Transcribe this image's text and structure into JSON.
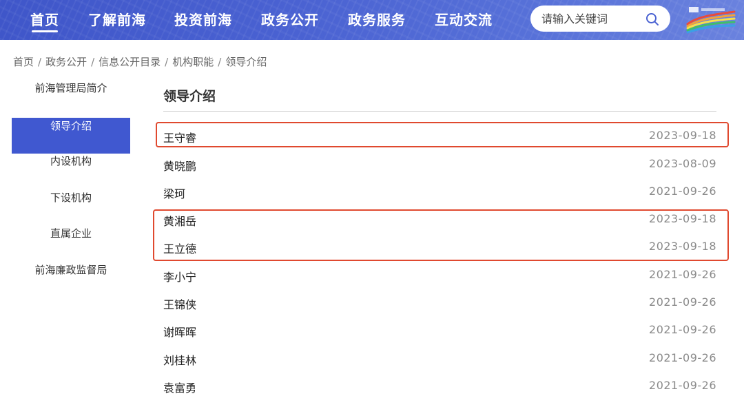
{
  "header": {
    "nav": [
      "首页",
      "了解前海",
      "投资前海",
      "政务公开",
      "政务服务",
      "互动交流"
    ],
    "active_index": 0,
    "search": {
      "placeholder": "请输入关键词"
    },
    "logo_alt": "前海"
  },
  "breadcrumb": [
    "首页",
    "政务公开",
    "信息公开目录",
    "机构职能",
    "领导介绍"
  ],
  "sidebar": {
    "items": [
      "前海管理局简介",
      "领导介绍",
      "内设机构",
      "下设机构",
      "直属企业",
      "前海廉政监督局"
    ],
    "active_index": 1
  },
  "main": {
    "title": "领导介绍",
    "rows": [
      {
        "name": "王守睿",
        "date": "2023-09-18"
      },
      {
        "name": "黄晓鹏",
        "date": "2023-08-09"
      },
      {
        "name": "梁珂",
        "date": "2021-09-26"
      },
      {
        "name": "黄湘岳",
        "date": "2023-09-18"
      },
      {
        "name": "王立德",
        "date": "2023-09-18"
      },
      {
        "name": "李小宁",
        "date": "2021-09-26"
      },
      {
        "name": "王锦侠",
        "date": "2021-09-26"
      },
      {
        "name": "谢晖晖",
        "date": "2021-09-26"
      },
      {
        "name": "刘桂林",
        "date": "2021-09-26"
      },
      {
        "name": "袁富勇",
        "date": "2021-09-26"
      }
    ]
  },
  "colors": {
    "header_blue": "#4a62d2",
    "active_blue": "#4058d0",
    "highlight_red": "#e0492f"
  }
}
